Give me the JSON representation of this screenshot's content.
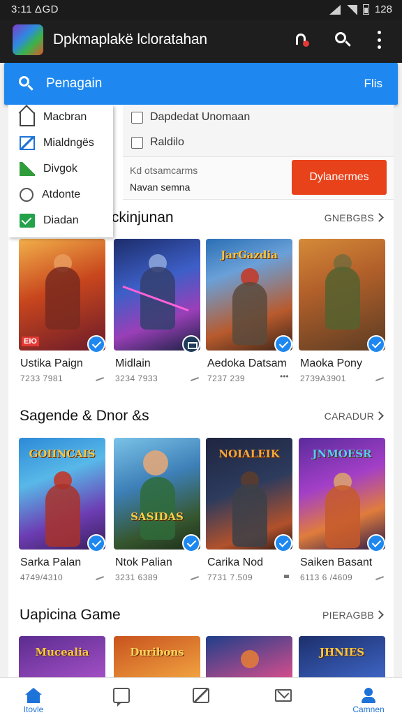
{
  "status_bar": {
    "time": "3:11 ΔGD",
    "battery": "128"
  },
  "app_bar": {
    "title": "Dpkmaplakë lcloratahan"
  },
  "search": {
    "placeholder": "Penagain",
    "filter_label": "Flis"
  },
  "side_menu": {
    "items": [
      {
        "label": "Macbran",
        "icon": "home-icon"
      },
      {
        "label": "Mialdngës",
        "icon": "edit-box-icon"
      },
      {
        "label": "Divgok",
        "icon": "flag-icon"
      },
      {
        "label": "Atdonte",
        "icon": "clock-icon"
      },
      {
        "label": "Diadan",
        "icon": "check-icon"
      }
    ]
  },
  "filters": {
    "options": [
      {
        "label": "Dapdedat Unomaan",
        "checked": false
      },
      {
        "label": "Raldilo",
        "checked": false
      }
    ]
  },
  "promo": {
    "line1": "Kd otsamcarms",
    "line2": "Navan semna",
    "button_label": "Dylanermes"
  },
  "sections": [
    {
      "title": "Ickinjunan",
      "more_label": "GNEBGBS",
      "cards": [
        {
          "name": "Ustika Paign",
          "meta": "7233 7981"
        },
        {
          "name": "Midlain",
          "meta": "3234 7933"
        },
        {
          "name": "Aedoka Datsam",
          "meta": "7237 239"
        },
        {
          "name": "Maoka Pony",
          "meta": "2739A3901"
        }
      ]
    },
    {
      "title": "Sagende & Dnor &s",
      "more_label": "CARADUR",
      "cards": [
        {
          "name": "Sarka Palan",
          "meta": "4749/4310"
        },
        {
          "name": "Ntok Palian",
          "meta": "3231 6389"
        },
        {
          "name": "Carika Nod",
          "meta": "7731 7.509"
        },
        {
          "name": "Saiken Basant",
          "meta": "6113 6 /4609"
        }
      ]
    },
    {
      "title": "Uapicina Game",
      "more_label": "PIERAGBB",
      "cards": [
        {
          "name": "",
          "meta": ""
        },
        {
          "name": "",
          "meta": ""
        },
        {
          "name": "",
          "meta": ""
        },
        {
          "name": "",
          "meta": ""
        }
      ]
    }
  ],
  "card_art_text": {
    "s1c3": "JarGazdia",
    "s2c1": "GOIINCAIS",
    "s2c2": "SASIDAS",
    "s2c3": "NOIALEIK",
    "s2c4": "JNMOESR",
    "s3c1": "Mucealia",
    "s3c2": "Duribons",
    "s3c4": "JHNIES",
    "s1c1_corner": "EIO"
  },
  "bottom_nav": {
    "items": [
      {
        "label": "Itovle",
        "icon": "home-icon",
        "active": true
      },
      {
        "label": "",
        "icon": "chat-icon",
        "active": false
      },
      {
        "label": "",
        "icon": "edit-icon",
        "active": false
      },
      {
        "label": "",
        "icon": "mail-icon",
        "active": false
      },
      {
        "label": "Camnen",
        "icon": "user-icon",
        "active": true
      }
    ]
  },
  "colors": {
    "accent": "#1e88f0",
    "promo_button": "#e8421b",
    "appbar": "#1e1e1e"
  }
}
